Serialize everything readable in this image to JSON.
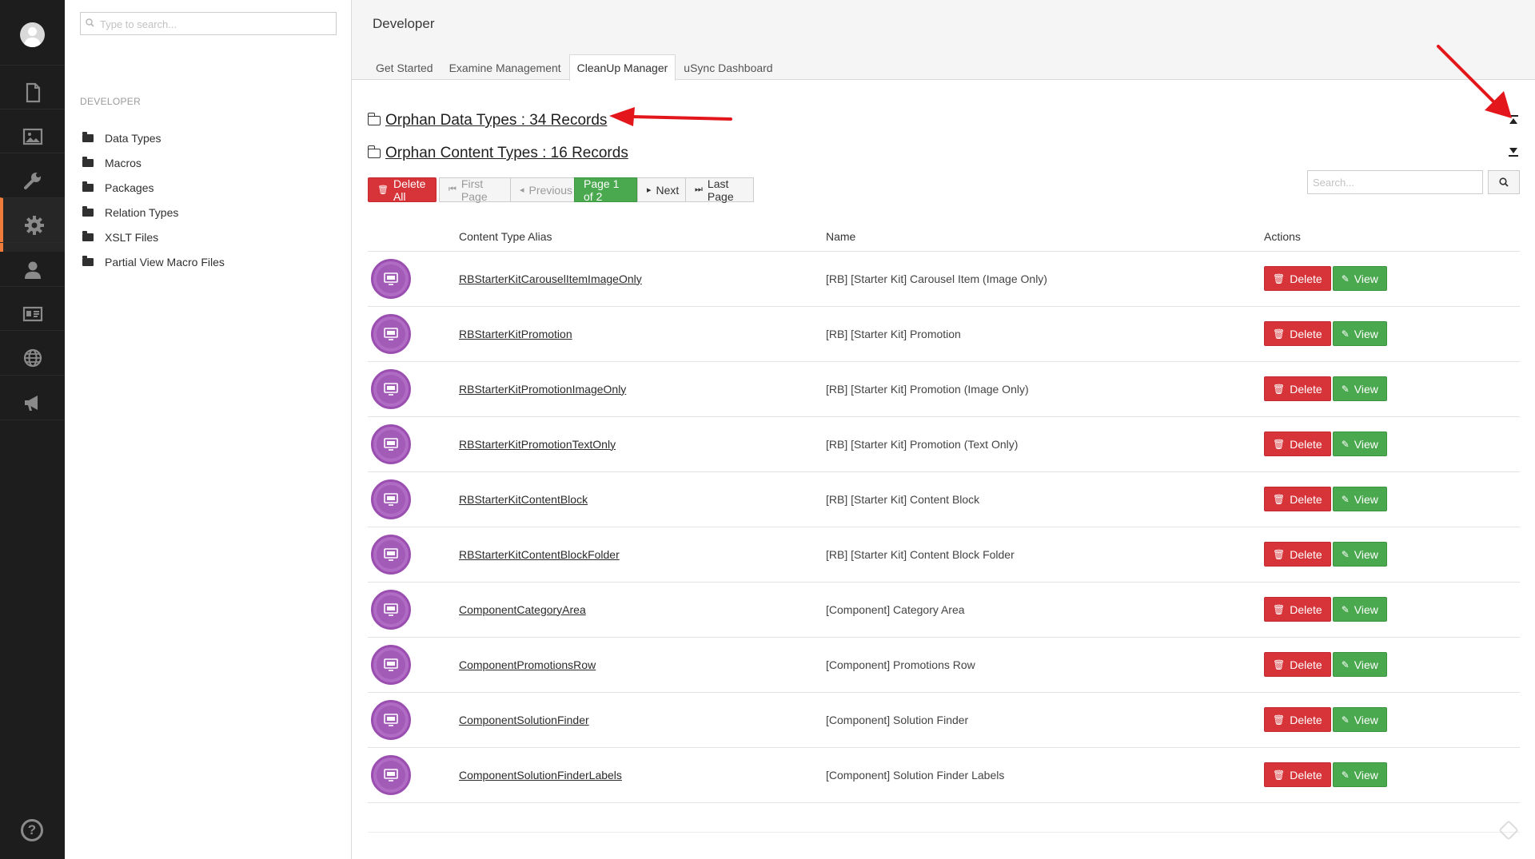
{
  "tree": {
    "search_placeholder": "Type to search...",
    "section_title": "DEVELOPER",
    "items": [
      {
        "label": "Data Types"
      },
      {
        "label": "Macros"
      },
      {
        "label": "Packages"
      },
      {
        "label": "Relation Types"
      },
      {
        "label": "XSLT Files"
      },
      {
        "label": "Partial View Macro Files"
      }
    ]
  },
  "header": {
    "title": "Developer",
    "tabs": [
      {
        "label": "Get Started"
      },
      {
        "label": "Examine Management"
      },
      {
        "label": "CleanUp Manager",
        "active": true
      },
      {
        "label": "uSync Dashboard"
      }
    ]
  },
  "orphans": {
    "data_types_link": "Orphan Data Types : 34 Records",
    "content_types_link": "Orphan Content Types : 16 Records"
  },
  "toolbar": {
    "delete_all": "Delete All",
    "first_page": "First Page",
    "previous": "Previous",
    "page_indicator": "Page 1 of 2",
    "next": "Next",
    "last_page": "Last Page",
    "search_placeholder": "Search..."
  },
  "table": {
    "columns": [
      "",
      "Content Type Alias",
      "Name",
      "Actions"
    ],
    "delete_label": "Delete",
    "view_label": "View",
    "rows": [
      {
        "alias": "RBStarterKitCarouselItemImageOnly",
        "name": "[RB] [Starter Kit] Carousel Item (Image Only)"
      },
      {
        "alias": "RBStarterKitPromotion",
        "name": "[RB] [Starter Kit] Promotion"
      },
      {
        "alias": "RBStarterKitPromotionImageOnly",
        "name": "[RB] [Starter Kit] Promotion (Image Only)"
      },
      {
        "alias": "RBStarterKitPromotionTextOnly",
        "name": "[RB] [Starter Kit] Promotion (Text Only)"
      },
      {
        "alias": "RBStarterKitContentBlock",
        "name": "[RB] [Starter Kit] Content Block"
      },
      {
        "alias": "RBStarterKitContentBlockFolder",
        "name": "[RB] [Starter Kit] Content Block Folder"
      },
      {
        "alias": "ComponentCategoryArea",
        "name": "[Component] Category Area"
      },
      {
        "alias": "ComponentPromotionsRow",
        "name": "[Component] Promotions Row"
      },
      {
        "alias": "ComponentSolutionFinder",
        "name": "[Component] Solution Finder"
      },
      {
        "alias": "ComponentSolutionFinderLabels",
        "name": "[Component] Solution Finder Labels"
      }
    ]
  },
  "colors": {
    "rail": "#1d1d1d",
    "rail_active_accent": "#f07c3b",
    "danger": "#d7343a",
    "success": "#4aa84f",
    "content_type_icon": "#b06bc4",
    "annotation_arrow": "#e3161b"
  },
  "icons": {
    "rail": [
      "user-avatar-icon",
      "content-icon",
      "media-icon",
      "settings-wrench-icon",
      "developer-gear-icon",
      "members-icon",
      "forms-icon",
      "translation-globe-icon",
      "marketing-megaphone-icon",
      "help-icon"
    ]
  }
}
